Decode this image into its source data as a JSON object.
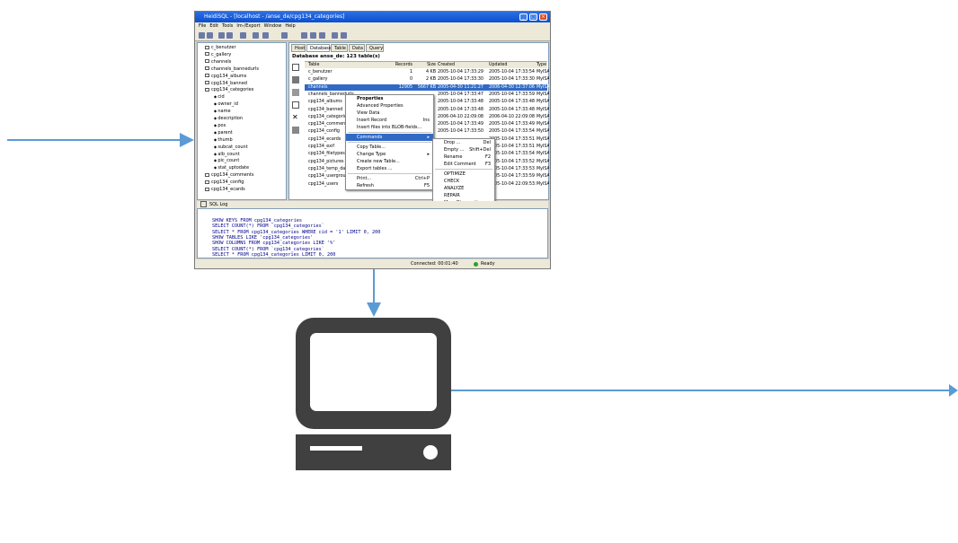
{
  "screenshot": {
    "window_title": "HeidiSQL - [localhost - /anse_de/cpg134_categories]",
    "menus": [
      "File",
      "Edit",
      "Tools",
      "Im-/Export",
      "Window",
      "Help"
    ],
    "tree_items": [
      {
        "label": "c_benutzer",
        "indent": 0
      },
      {
        "label": "c_gallery",
        "indent": 0
      },
      {
        "label": "channels",
        "indent": 0
      },
      {
        "label": "channels_bannedurls",
        "indent": 0
      },
      {
        "label": "cpg134_albums",
        "indent": 0
      },
      {
        "label": "cpg134_banned",
        "indent": 0
      },
      {
        "label": "cpg134_categories",
        "indent": 0
      },
      {
        "label": "cid",
        "indent": 1
      },
      {
        "label": "owner_id",
        "indent": 1
      },
      {
        "label": "name",
        "indent": 1
      },
      {
        "label": "description",
        "indent": 1
      },
      {
        "label": "pos",
        "indent": 1
      },
      {
        "label": "parent",
        "indent": 1
      },
      {
        "label": "thumb",
        "indent": 1
      },
      {
        "label": "subcat_count",
        "indent": 1
      },
      {
        "label": "alb_count",
        "indent": 1
      },
      {
        "label": "pic_count",
        "indent": 1
      },
      {
        "label": "stat_uptodate",
        "indent": 1
      },
      {
        "label": "cpg134_comments",
        "indent": 0
      },
      {
        "label": "cpg134_config",
        "indent": 0
      },
      {
        "label": "cpg134_ecards",
        "indent": 0
      }
    ],
    "tabs": [
      "Host",
      "Database",
      "Table",
      "Data",
      "Query"
    ],
    "db_header": "Database anse_de: 123 table(s)",
    "columns": [
      "Table",
      "Records",
      "Size",
      "Created",
      "Updated",
      "Type"
    ],
    "rows": [
      [
        "c_benutzer",
        "1",
        "4 KB",
        "2005-10-04 17:33:29",
        "2005-10-04 17:33:54",
        "MyISA"
      ],
      [
        "c_gallery",
        "0",
        "2 KB",
        "2005-10-04 17:33:30",
        "2005-10-04 17:33:30",
        "MyISA"
      ],
      [
        "channels",
        "12905",
        "5667 KB",
        "2005-04-30 11:21:27",
        "2006-04-30 12:37:06",
        "MyISA"
      ],
      [
        "channels_bannedurls",
        "",
        "",
        "2005-10-04 17:33:47",
        "2005-10-04 17:33:59",
        "MyISA"
      ],
      [
        "cpg134_albums",
        "",
        "",
        "2005-10-04 17:33:48",
        "2005-10-04 17:33:48",
        "MyISA"
      ],
      [
        "cpg134_banned",
        "",
        "",
        "2005-10-04 17:33:48",
        "2005-10-04 17:33:48",
        "MyISA"
      ],
      [
        "cpg134_categories",
        "",
        "",
        "2006-04-10 22:09:08",
        "2006-04-10 22:09:08",
        "MyISA"
      ],
      [
        "cpg134_comments",
        "",
        "",
        "2005-10-04 17:33:49",
        "2005-10-04 17:33:49",
        "MyISA"
      ],
      [
        "cpg134_config",
        "",
        "",
        "2005-10-04 17:33:50",
        "2005-10-04 17:33:54",
        "MyISA"
      ],
      [
        "cpg134_ecards",
        "",
        "",
        "",
        "2005-10-04 17:33:51",
        "MyISA"
      ],
      [
        "cpg134_exif",
        "",
        "",
        "",
        "2005-10-04 17:33:51",
        "MyISA"
      ],
      [
        "cpg134_filetypes",
        "",
        "",
        "",
        "2005-10-04 17:33:54",
        "MyISA"
      ],
      [
        "cpg134_pictures",
        "",
        "",
        "",
        "2005-10-04 17:33:52",
        "MyISA"
      ],
      [
        "cpg134_temp_data",
        "",
        "",
        "",
        "2005-10-04 17:33:53",
        "MyISA"
      ],
      [
        "cpg134_usergroups",
        "",
        "",
        "",
        "2005-10-04 17:33:59",
        "MyISA"
      ],
      [
        "cpg134_users",
        "",
        "",
        "",
        "2005-10-04 22:09:53:20",
        "MyISA"
      ]
    ],
    "context_menu": [
      {
        "label": "Properties",
        "shortcut": "",
        "bold": true
      },
      {
        "label": "Advanced Properties",
        "shortcut": ""
      },
      {
        "label": "View Data",
        "shortcut": ""
      },
      {
        "label": "Insert Record",
        "shortcut": "Ins"
      },
      {
        "label": "Insert files into BLOB-fields...",
        "shortcut": ""
      },
      {
        "sep": true
      },
      {
        "label": "Commands",
        "shortcut": "",
        "highlight": true,
        "submenu": true
      },
      {
        "sep": true
      },
      {
        "label": "Copy Table...",
        "shortcut": ""
      },
      {
        "label": "Change Type",
        "shortcut": "",
        "submenu": true
      },
      {
        "label": "Create new Table...",
        "shortcut": ""
      },
      {
        "label": "Export tables ...",
        "shortcut": ""
      },
      {
        "sep": true
      },
      {
        "label": "Print...",
        "shortcut": "Ctrl+P"
      },
      {
        "label": "Refresh",
        "shortcut": "F5"
      }
    ],
    "submenu": [
      {
        "label": "Drop ...",
        "shortcut": "Del"
      },
      {
        "label": "Empty ...",
        "shortcut": "Shift+Del"
      },
      {
        "label": "Rename",
        "shortcut": "F2"
      },
      {
        "label": "Edit Comment",
        "shortcut": "F3"
      },
      {
        "sep": true
      },
      {
        "label": "OPTIMIZE",
        "shortcut": ""
      },
      {
        "label": "CHECK",
        "shortcut": ""
      },
      {
        "label": "ANALYZE",
        "shortcut": ""
      },
      {
        "label": "REPAIR",
        "shortcut": ""
      },
      {
        "label": "More Diagnostics...",
        "shortcut": ""
      }
    ],
    "log_title": "SQL Log",
    "log_lines": [
      "SHOW KEYS FROM cpg134_categories",
      "SELECT COUNT(*) FROM `cpg134_categories`",
      "SELECT * FROM cpg134_categories WHERE cid = '1' LIMIT 0, 200",
      "SHOW TABLES LIKE 'cpg134_categories'",
      "SHOW COLUMNS FROM cpg134_categories LIKE '%'",
      "SELECT COUNT(*) FROM `cpg134_categories`",
      "SELECT * FROM cpg134_categories LIMIT 0, 200"
    ],
    "status_connected": "Connected: 00:01:40",
    "status_ready": "Ready"
  },
  "colors": {
    "arrow": "#5b9bd5",
    "computer": "#404040"
  }
}
